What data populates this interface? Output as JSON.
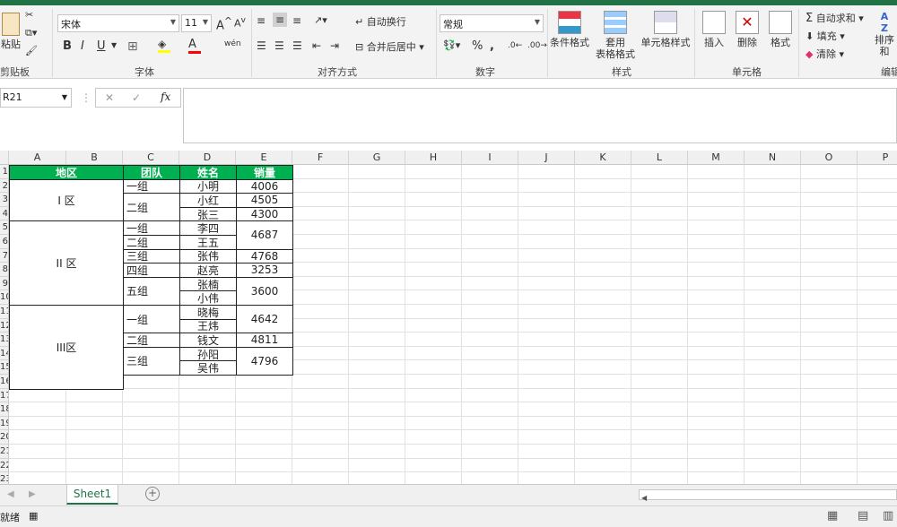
{
  "ribbon": {
    "clipboard": {
      "paste_label": "粘贴",
      "group_label": "剪贴板"
    },
    "font": {
      "font_name": "宋体",
      "font_size": "11",
      "group_label": "字体",
      "bold": "B",
      "italic": "I",
      "underline": "U",
      "grow": "A",
      "shrink": "A",
      "font_color_glyph": "A",
      "wen": "wén"
    },
    "align": {
      "wrap_label": "自动换行",
      "merge_label": "合并后居中",
      "group_label": "对齐方式"
    },
    "number": {
      "format": "常规",
      "group_label": "数字",
      "percent": "%",
      "comma": ","
    },
    "styles": {
      "conditional": "条件格式",
      "table_fmt_1": "套用",
      "table_fmt_2": "表格格式",
      "cell_style": "单元格样式",
      "group_label": "样式"
    },
    "cells": {
      "insert": "插入",
      "delete": "删除",
      "format": "格式",
      "group_label": "单元格"
    },
    "editing": {
      "autosum": "自动求和",
      "fill": "填充",
      "clear": "清除",
      "sort": "排序和",
      "group_label": "编辑"
    }
  },
  "formula_bar": {
    "name_box": "R21",
    "fx": "fx",
    "cancel": "✕",
    "confirm": "✓",
    "value": ""
  },
  "columns": [
    "A",
    "B",
    "C",
    "D",
    "E",
    "F",
    "G",
    "H",
    "I",
    "J",
    "K",
    "L",
    "M",
    "N",
    "O",
    "P"
  ],
  "rows": [
    "1",
    "2",
    "3",
    "4",
    "5",
    "6",
    "7",
    "8",
    "9",
    "10",
    "11",
    "12",
    "13",
    "14",
    "15",
    "16",
    "17",
    "18",
    "19",
    "20",
    "21",
    "22",
    "23"
  ],
  "table": {
    "headers": {
      "region": "地区",
      "team": "团队",
      "name": "姓名",
      "sales": "销量"
    },
    "regions": [
      "I  区",
      "II 区",
      "III区"
    ],
    "teams": [
      "一组",
      "二组",
      "一组",
      "二组",
      "三组",
      "四组",
      "五组",
      "一组",
      "二组",
      "三组"
    ],
    "names": [
      "小明",
      "小红",
      "张三",
      "李四",
      "王五",
      "张伟",
      "赵亮",
      "张楠",
      "小伟",
      "晓梅",
      "王炜",
      "钱文",
      "孙阳",
      "吴伟"
    ],
    "sales": [
      "4006",
      "4505",
      "4300",
      "4687",
      "4768",
      "3253",
      "3600",
      "4642",
      "4811",
      "4796"
    ]
  },
  "sheet_tabs": {
    "active": "Sheet1",
    "add": "+"
  },
  "status_bar": {
    "ready": "就绪"
  },
  "colors": {
    "accent": "#217346",
    "header_fill": "#00b050"
  }
}
